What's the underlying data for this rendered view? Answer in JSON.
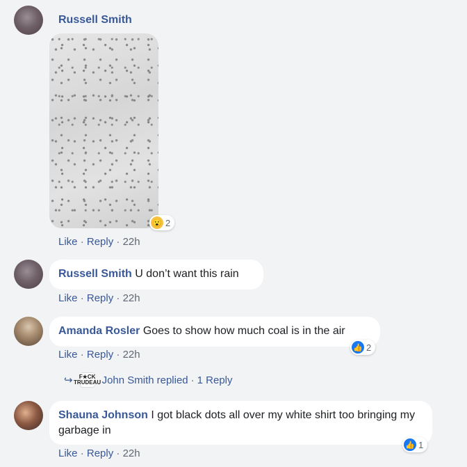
{
  "comments": [
    {
      "author": "Russell Smith",
      "text": "",
      "has_photo": true,
      "reaction": {
        "icon": "wow-icon",
        "count": "2"
      },
      "actions": {
        "like": "Like",
        "reply": "Reply",
        "time": "22h"
      }
    },
    {
      "author": "Russell Smith",
      "text": "U don’t want this rain",
      "actions": {
        "like": "Like",
        "reply": "Reply",
        "time": "22h"
      }
    },
    {
      "author": "Amanda Rosler",
      "text": "Goes to show how much coal is in the air",
      "reaction": {
        "icon": "like-icon",
        "count": "2"
      },
      "actions": {
        "like": "Like",
        "reply": "Reply",
        "time": "22h"
      },
      "replies": {
        "replier": "John Smith",
        "replied": "replied",
        "count_text": "1 Reply"
      }
    },
    {
      "author": "Shauna Johnson",
      "text": "I got black dots all over my white shirt too bringing my garbage in",
      "reaction": {
        "icon": "like-icon",
        "count": "1"
      },
      "actions": {
        "like": "Like",
        "reply": "Reply",
        "time": "22h"
      }
    }
  ],
  "separator": "·",
  "colors": {
    "link": "#385898",
    "background": "#f2f3f5",
    "like_blue": "#1877f2",
    "wow_yellow": "#f7c240"
  }
}
